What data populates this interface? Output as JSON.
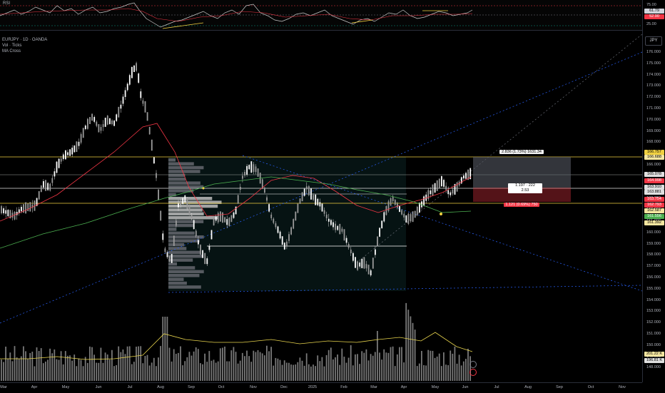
{
  "rsi": {
    "label": "RSI",
    "ticks": [
      "75.00",
      "50.00",
      "25.00"
    ],
    "value_tag": "61.79",
    "ma_tag": "52.90",
    "colors": {
      "line": "#c0c0c0",
      "ma": "#f23645",
      "div": "#f0d040"
    }
  },
  "legend": {
    "symbol": "EURJPY · 1D · OANDA",
    "vol": "Vol · Ticks",
    "ma": "MA Cross"
  },
  "currency_button": "JPY",
  "price_ticks": [
    "176.000",
    "175.000",
    "174.000",
    "173.000",
    "172.000",
    "171.000",
    "170.000",
    "169.000",
    "168.000",
    "167.000",
    "166.000",
    "165.000",
    "164.000",
    "163.000",
    "162.000",
    "161.000",
    "160.000",
    "159.000",
    "158.000",
    "157.000",
    "156.000",
    "155.000",
    "154.000",
    "153.000",
    "152.000",
    "151.000",
    "150.000",
    "149.000",
    "148.000"
  ],
  "price_tags": [
    {
      "text": "166.757",
      "kind": "yellow"
    },
    {
      "text": "166.688",
      "kind": "yellowlight"
    },
    {
      "text": "165.078",
      "kind": "plain"
    },
    {
      "text": "164.998",
      "kind": "red"
    },
    {
      "text": "163.910",
      "kind": "plain"
    },
    {
      "text": "163.881",
      "kind": "plain"
    },
    {
      "text": "163.754",
      "kind": "red"
    },
    {
      "text": "162.793",
      "kind": "red"
    },
    {
      "text": "162.587",
      "kind": "yellowlight"
    },
    {
      "text": "161.556",
      "kind": "green"
    },
    {
      "text": "161.392",
      "kind": "yellowlight"
    },
    {
      "text": "201.22 K",
      "kind": "yellowlight"
    },
    {
      "text": "196.81 K",
      "kind": "plain"
    }
  ],
  "time_ticks": [
    "Mar",
    "Apr",
    "May",
    "Jun",
    "Jul",
    "Aug",
    "Sep",
    "Oct",
    "Nov",
    "Dec",
    "2025",
    "Feb",
    "Mar",
    "Apr",
    "May",
    "Jun",
    "Jul",
    "Aug",
    "Sep",
    "Oct",
    "Nov"
  ],
  "position": {
    "target_label": "2.836 (1.73%) 1631.34",
    "ratio_line1": "1.197 · 222",
    "ratio_line2": "2.53",
    "stop_label": "1.121 (0.69%) 750"
  },
  "colors": {
    "up": "#ffffff",
    "down": "#ffffff",
    "ma_fast": "#f23645",
    "ma_slow": "#4caf50",
    "hline": "#f0d040",
    "trend": "#2962ff",
    "vol": "#a0a0a0",
    "vol_ma": "#e8d44d"
  }
}
